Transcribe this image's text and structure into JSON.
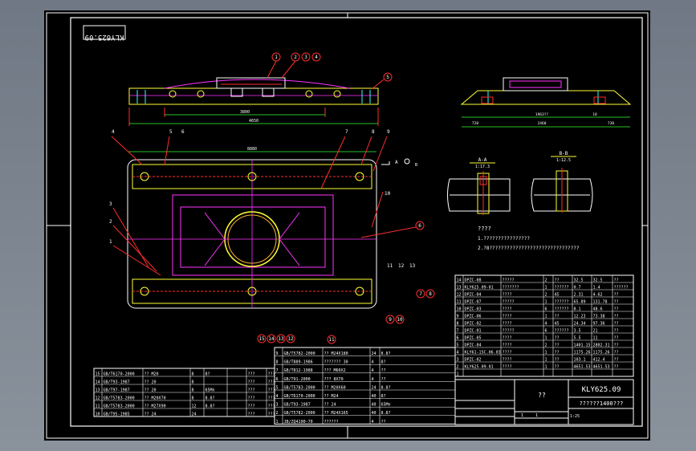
{
  "drawing": {
    "title_block_code": "KLY625.09",
    "stamp_code": "KLY625.09",
    "name_cell": "??",
    "ratio_cell": "??????1400???",
    "sheet_info": [
      "1",
      "1",
      "1:25"
    ]
  },
  "views": {
    "top": {
      "dims": [
        "3800",
        "4650"
      ],
      "balloons": [
        "1",
        "2",
        "3",
        "4",
        "5"
      ]
    },
    "side": {
      "dims": [
        "720",
        "1963??",
        "2460",
        "18",
        "730",
        "18"
      ]
    },
    "plan": {
      "overall_dim": "8880",
      "balloons": [
        "4",
        "5",
        "6",
        "7",
        "8",
        "9",
        "10",
        "3",
        "2",
        "1",
        "6",
        "11",
        "12",
        "13",
        "7",
        "8",
        "15",
        "14",
        "13",
        "12",
        "11",
        "9",
        "10"
      ],
      "section_mark": "A",
      "section_mark_b": "B"
    },
    "section_a": {
      "title": "A-A",
      "scale": "1:17.3"
    },
    "section_b": {
      "title": "B-B",
      "scale": "1:12.5"
    }
  },
  "notes": {
    "heading": "????",
    "lines": [
      "1.????????????????",
      "2.?8???????????????????????????????"
    ]
  },
  "bom_right": {
    "rows": [
      [
        "14",
        "DPZC-08",
        "?????",
        "2",
        "??",
        "32.5",
        "32.5",
        "??"
      ],
      [
        "13",
        "KLY625.09-01",
        "???????",
        "1",
        "??????",
        "0.7",
        "1.4",
        "??????"
      ],
      [
        "12",
        "DPZC-04",
        "????",
        "2",
        "45",
        "2.31",
        "4.62",
        "??"
      ],
      [
        "11",
        "DPZC-07",
        "?????",
        "1",
        "??????",
        "65.89",
        "131.78",
        "??"
      ],
      [
        "10",
        "DPZC-03",
        "????",
        "6",
        "??????",
        "8.1",
        "48.6",
        "??"
      ],
      [
        "9",
        "DPZC-06",
        "????",
        "1",
        "??",
        "12.23",
        "73.38",
        "??"
      ],
      [
        "8",
        "DPZC-02",
        "????",
        "4",
        "45",
        "24.34",
        "97.36",
        "??"
      ],
      [
        "7",
        "DPZC-01",
        "?????",
        "6",
        "??????",
        "3.5",
        "21",
        "??"
      ],
      [
        "6",
        "DPZC-05",
        "????",
        "1",
        "??",
        "5.5",
        "11",
        "??"
      ],
      [
        "5",
        "DPZC-04",
        "????",
        "2",
        "??",
        "1401.15",
        "2802.31",
        "??"
      ],
      [
        "4",
        "KLY61-15C.06.03",
        "????",
        "1",
        "??",
        "1175.26",
        "1175.26",
        "??"
      ],
      [
        "3",
        "DPZC-02",
        "????",
        "1",
        "??",
        "103.1",
        "412.4",
        "??"
      ],
      [
        "2",
        "KLY625.09.01",
        "????",
        "1",
        "??",
        "4651.53",
        "4651.53",
        "??"
      ],
      [
        "1",
        "",
        "",
        "",
        "",
        "",
        "",
        ""
      ]
    ]
  },
  "bom_left": {
    "rows": [
      [
        "15",
        "GB/T6170-2000",
        "?? M20",
        "8",
        "8?",
        "",
        "???",
        "???"
      ],
      [
        "14",
        "GB/T93-1987",
        "?? 20",
        "8",
        "",
        "",
        "???",
        "???"
      ],
      [
        "13",
        "GB/T97-1987",
        "?? 20",
        "8",
        "65Mn",
        "",
        "???",
        "???"
      ],
      [
        "12",
        "GB/T5783-2000",
        "?? M20X70",
        "8",
        "8.8?",
        "",
        "???",
        "???"
      ],
      [
        "11",
        "GB/T5783-2000",
        "?? M27X90",
        "12",
        "8.8?",
        "",
        "???",
        "???"
      ],
      [
        "10",
        "GB/T95-1985",
        "?? 24",
        "24",
        "",
        "",
        "???",
        "???"
      ]
    ]
  },
  "bom_mid": {
    "rows": [
      [
        "9",
        "GB/T5782-2000",
        "?? M24X180",
        "24",
        "8.8?"
      ],
      [
        "8",
        "GB/T889-1986",
        "??????? 30",
        "4",
        "8?"
      ],
      [
        "7",
        "GB/T812-1988",
        "??? M60X2",
        "4",
        "??"
      ],
      [
        "6",
        "GB/T91-2000",
        "??? 8X70",
        "4",
        "??"
      ],
      [
        "5",
        "GB/T5783-2000",
        "?? M20X60",
        "24",
        "8.8?"
      ],
      [
        "4",
        "GB/T6170-2000",
        "?? M24",
        "40",
        "8?"
      ],
      [
        "3",
        "GB/T93-1987",
        "?? 24",
        "40",
        "65Mn"
      ],
      [
        "2",
        "GB/T5782-2000",
        "?? M24X165",
        "40",
        "8.8?"
      ],
      [
        "1",
        "JB/ZQ4100-70",
        "??????",
        "4",
        "??"
      ]
    ]
  },
  "colors": {
    "frame": "#ffffff",
    "red": "#ff2d2d",
    "yellow": "#ffff33",
    "green": "#33ff33",
    "magenta": "#ff33ff",
    "cyan": "#33ffff",
    "orange": "#ffb233"
  }
}
